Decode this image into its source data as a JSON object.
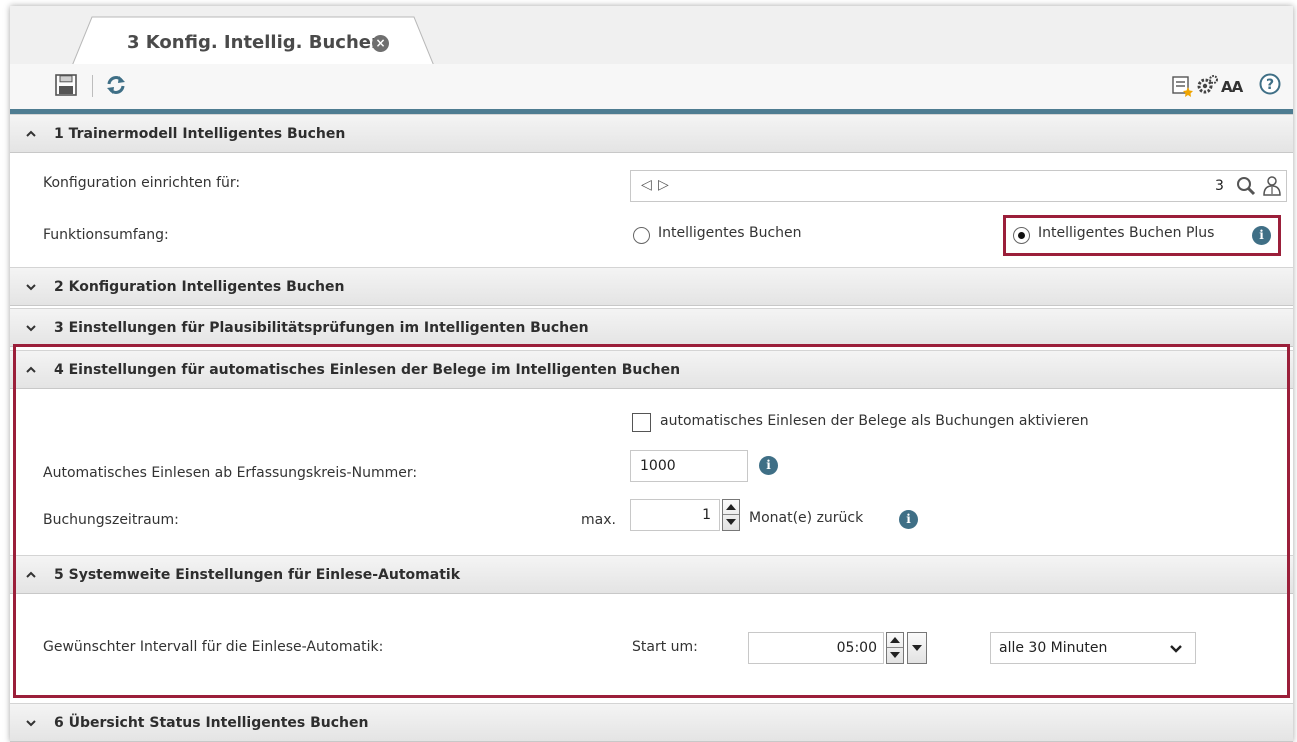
{
  "tab": {
    "title": "3 Konfig. Intellig. Buchen",
    "close_glyph": "×"
  },
  "toolbar": {
    "aa_label": "AA",
    "icons": [
      "save-icon",
      "refresh-icon",
      "notes-star-icon",
      "gears-icon",
      "font-size-icon",
      "help-icon"
    ]
  },
  "colors": {
    "accent": "#4e7c91",
    "highlight": "#9b1f3a",
    "info": "#3f6f86"
  },
  "sections": {
    "s1": {
      "title": "1 Trainermodell Intelligentes Buchen",
      "config_label": "Konfiguration einrichten für:",
      "config_value": "3",
      "nav_prev": "◁",
      "nav_next": "▷",
      "scope_label": "Funktionsumfang:",
      "option_basic": "Intelligentes Buchen",
      "option_plus": "Intelligentes Buchen Plus",
      "selected": "Intelligentes Buchen Plus"
    },
    "s2": {
      "title": "2 Konfiguration Intelligentes Buchen"
    },
    "s3": {
      "title": "3 Einstellungen für Plausibilitätsprüfungen im Intelligenten Buchen"
    },
    "s4": {
      "title": "4 Einstellungen für automatisches Einlesen der Belege im Intelligenten Buchen",
      "auto_checkbox_label": "automatisches Einlesen der Belege als Buchungen aktivieren",
      "auto_checked": false,
      "start_number_label": "Automatisches Einlesen ab Erfassungskreis-Nummer:",
      "start_number_value": "1000",
      "period_label": "Buchungszeitraum:",
      "period_prefix": "max.",
      "period_value": "1",
      "period_suffix": "Monat(e) zurück"
    },
    "s5": {
      "title": "5 Systemweite Einstellungen für Einlese-Automatik",
      "interval_label": "Gewünschter Intervall für die Einlese-Automatik:",
      "start_label": "Start um:",
      "start_time": "05:00",
      "interval_value": "alle 30 Minuten"
    },
    "s6": {
      "title": "6 Übersicht Status Intelligentes Buchen"
    }
  },
  "info_glyph": "i"
}
